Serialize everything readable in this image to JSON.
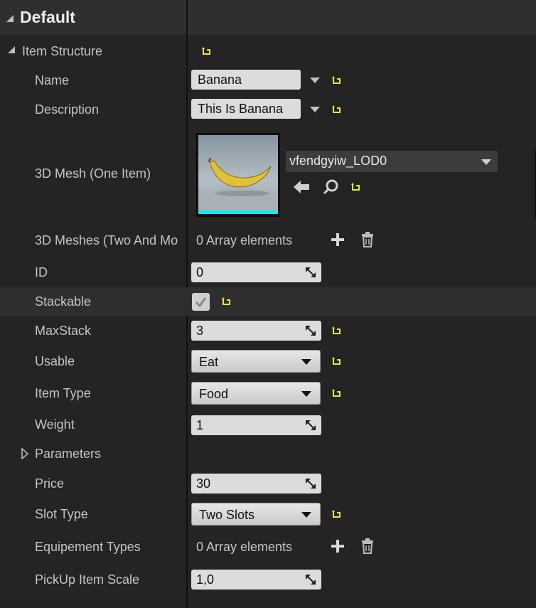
{
  "category": {
    "title": "Default"
  },
  "struct": {
    "label": "Item Structure"
  },
  "props": {
    "name": {
      "label": "Name",
      "value": "Banana"
    },
    "description": {
      "label": "Description",
      "value": "This Is Banana"
    },
    "mesh": {
      "label": "3D Mesh (One Item)",
      "value": "vfendgyiw_LOD0"
    },
    "meshes": {
      "label": "3D Meshes (Two And Mo",
      "value": "0 Array elements"
    },
    "id": {
      "label": "ID",
      "value": "0"
    },
    "stackable": {
      "label": "Stackable",
      "checked": true
    },
    "maxstack": {
      "label": "MaxStack",
      "value": "3"
    },
    "usable": {
      "label": "Usable",
      "value": "Eat"
    },
    "item_type": {
      "label": "Item Type",
      "value": "Food"
    },
    "weight": {
      "label": "Weight",
      "value": "1"
    },
    "parameters": {
      "label": "Parameters"
    },
    "price": {
      "label": "Price",
      "value": "30"
    },
    "slot_type": {
      "label": "Slot Type",
      "value": "Two Slots"
    },
    "equip_types": {
      "label": "Equipement Types",
      "value": "0 Array elements"
    },
    "pickup_scale": {
      "label": "PickUp Item Scale",
      "value": "1,0"
    }
  },
  "colors": {
    "reset_arrow": "#e8e83a",
    "thumb_bar": "#19e3ef"
  }
}
